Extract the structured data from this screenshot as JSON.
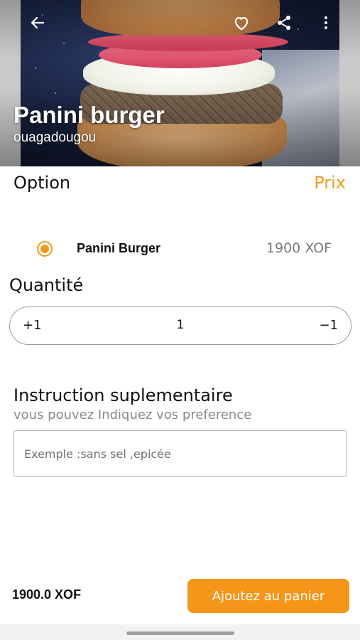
{
  "header": {
    "title": "Panini burger",
    "location": "ouagadougou",
    "icons": [
      "back-arrow-icon",
      "heart-icon",
      "share-icon",
      "more-vertical-icon"
    ]
  },
  "options": {
    "title": "Option",
    "price_title": "Prix",
    "items": [
      {
        "name": "Panini Burger",
        "price": "1900 XOF",
        "selected": true
      }
    ]
  },
  "quantity": {
    "title": "Quantité",
    "plus_label": "+1",
    "value": "1",
    "minus_label": "−1"
  },
  "instruction": {
    "title": "Instruction suplementaire",
    "subtitle": "vous pouvez Indiquez vos preference",
    "placeholder": "Exemple :sans sel ,epicée",
    "value": ""
  },
  "footer": {
    "total": "1900.0 XOF",
    "add_to_cart_label": "Ajoutez au panier"
  },
  "colors": {
    "accent": "#f5951a",
    "text": "#111111",
    "muted": "#8a8a8a"
  }
}
